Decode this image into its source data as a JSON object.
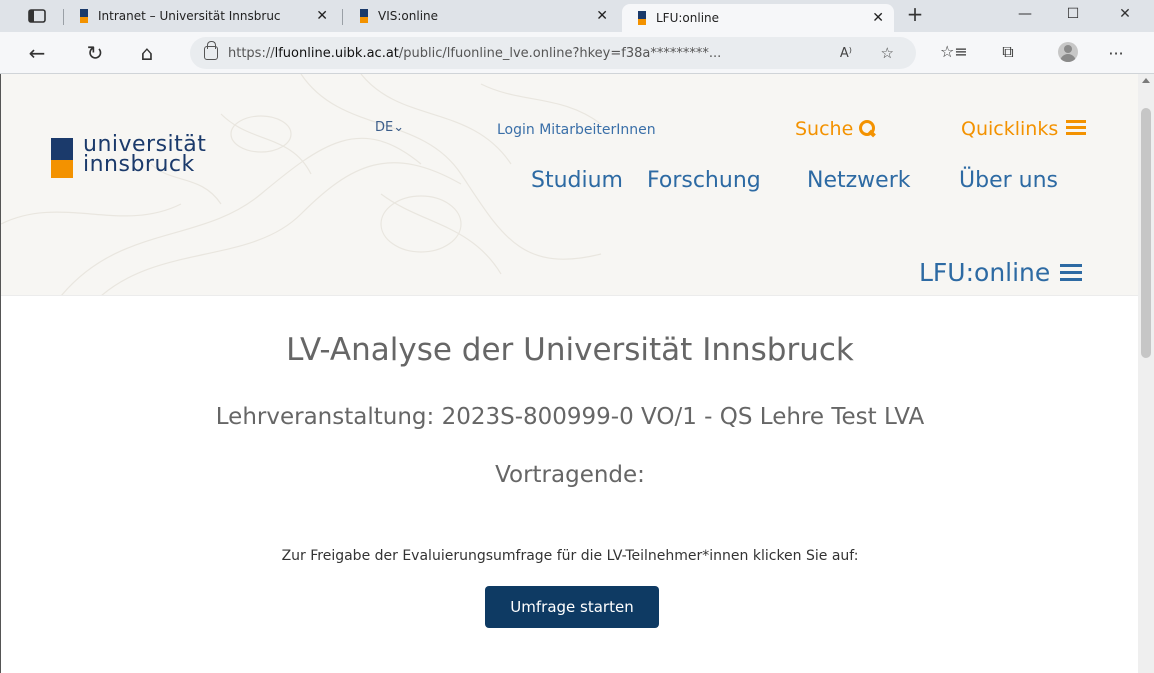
{
  "browser": {
    "tabs": [
      {
        "title": "Intranet – Universität Innsbruc",
        "close": "✕"
      },
      {
        "title": "VIS:online",
        "close": "✕"
      },
      {
        "title": "LFU:online",
        "close": "✕"
      }
    ],
    "new_tab": "+",
    "window": {
      "minimize": "—",
      "maximize": "☐",
      "close": "✕"
    },
    "nav": {
      "back": "←",
      "refresh": "↻",
      "home": "⌂"
    },
    "url": {
      "prefix": "https://",
      "domain": "lfuonline.uibk.ac.at",
      "path": "/public/lfuonline_lve.online?hkey=f38a*********...",
      "read_aloud": "A⁾",
      "favorite": "☆"
    },
    "tools": {
      "favorites": "☆≡",
      "collections": "⧉",
      "more": "···"
    }
  },
  "header": {
    "logo": {
      "line1": "universität",
      "line2": "innsbruck"
    },
    "language": "DE⌄",
    "login": "Login MitarbeiterInnen",
    "search": "Suche",
    "quicklinks": "Quicklinks",
    "nav": [
      "Studium",
      "Forschung",
      "Netzwerk",
      "Über uns"
    ],
    "app_name": "LFU:online"
  },
  "main": {
    "title": "LV-Analyse der Universität Innsbruck",
    "course": "Lehrveranstaltung: 2023S-800999-0 VO/1 - QS Lehre Test LVA",
    "lecturer_label": "Vortragende:",
    "instruction": "Zur Freigabe der Evaluierungsumfrage für die LV-Teilnehmer*innen klicken Sie auf:",
    "button": "Umfrage starten"
  },
  "colors": {
    "navy": "#1b3a6b",
    "orange": "#f39200",
    "link_blue": "#2d6aa3",
    "button": "#0e3a63"
  }
}
